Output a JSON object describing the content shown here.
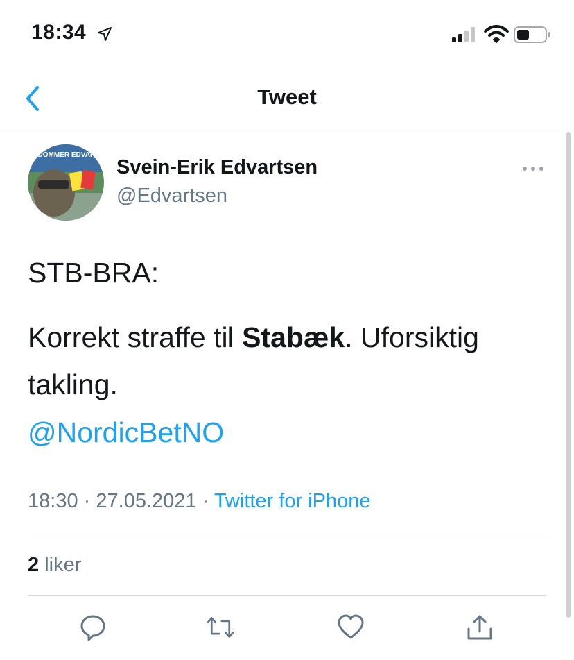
{
  "status_bar": {
    "time": "18:34",
    "icons": [
      "location-arrow-icon",
      "cellular-signal-icon",
      "wifi-icon",
      "battery-icon"
    ]
  },
  "nav": {
    "title": "Tweet",
    "back_icon": "chevron-left-icon"
  },
  "tweet": {
    "author_name": "Svein-Erik Edvartsen",
    "author_handle": "@Edvartsen",
    "avatar_text": "KOR E DOMMER EDVARTSEN?",
    "line1": "STB-BRA:",
    "line2_before": "Korrekt straffe til ",
    "line2_bold": "Stabæk",
    "line2_after": ". Uforsiktig takling.",
    "mention": "@NordicBetNO",
    "time": "18:30",
    "date": "27.05.2021",
    "separator": "·",
    "source": "Twitter for iPhone",
    "likes_count": "2",
    "likes_label": "liker"
  },
  "actions": [
    "reply-icon",
    "retweet-icon",
    "like-icon",
    "share-icon"
  ],
  "colors": {
    "accent": "#1da1f2",
    "text": "#14171a",
    "secondary": "#657786",
    "divider": "#d6d9dc"
  }
}
